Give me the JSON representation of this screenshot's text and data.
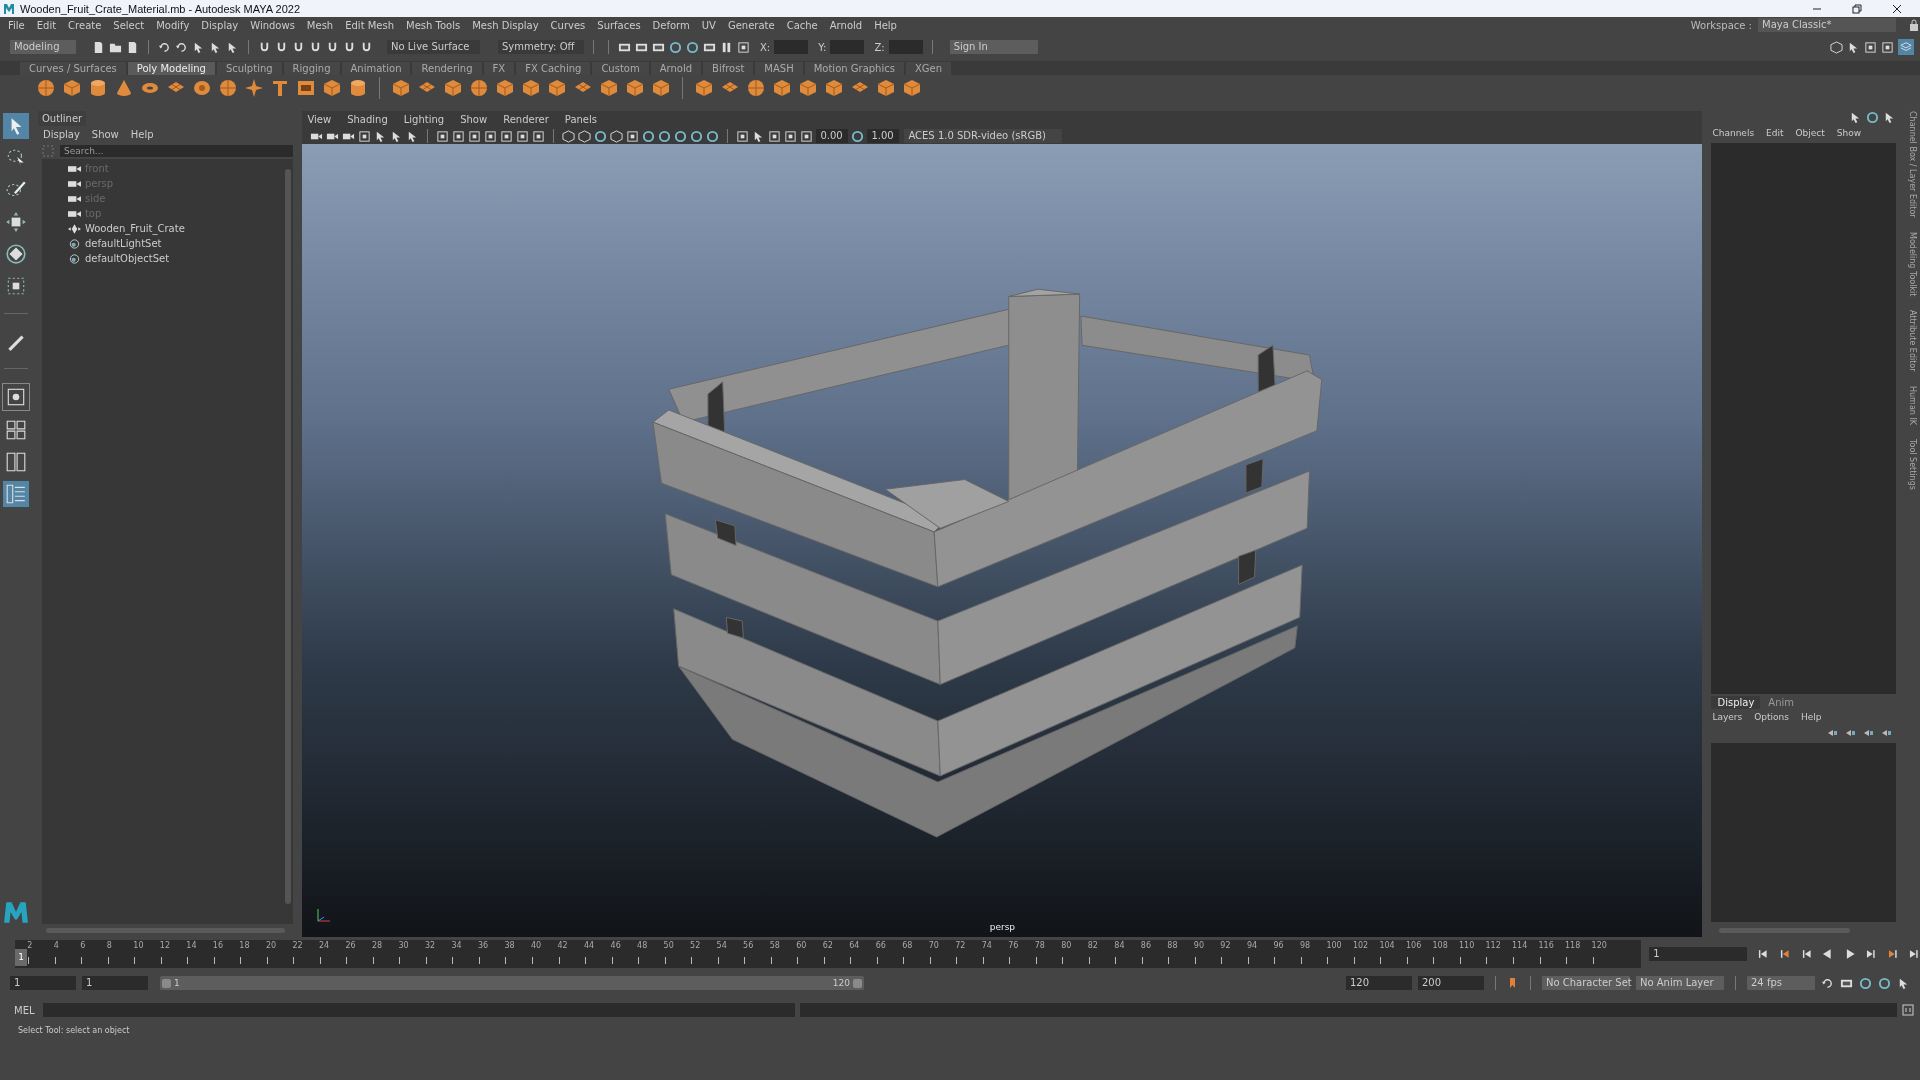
{
  "window": {
    "title": "Wooden_Fruit_Crate_Material.mb - Autodesk MAYA 2022"
  },
  "menu": [
    "File",
    "Edit",
    "Create",
    "Select",
    "Modify",
    "Display",
    "Windows",
    "Mesh",
    "Edit Mesh",
    "Mesh Tools",
    "Mesh Display",
    "Curves",
    "Surfaces",
    "Deform",
    "UV",
    "Generate",
    "Cache",
    "Arnold",
    "Help"
  ],
  "workspace": {
    "label": "Workspace :",
    "value": "Maya Classic*"
  },
  "status_line": {
    "menu_set": "Modeling",
    "live_surface": "No Live Surface",
    "symmetry": "Symmetry: Off",
    "x_label": "X:",
    "y_label": "Y:",
    "z_label": "Z:",
    "sign_in": "Sign In"
  },
  "shelf_tabs": [
    {
      "label": "Curves / Surfaces",
      "selected": false
    },
    {
      "label": "Poly Modeling",
      "selected": true
    },
    {
      "label": "Sculpting",
      "selected": false
    },
    {
      "label": "Rigging",
      "selected": false
    },
    {
      "label": "Animation",
      "selected": false
    },
    {
      "label": "Rendering",
      "selected": false
    },
    {
      "label": "FX",
      "selected": false
    },
    {
      "label": "FX Caching",
      "selected": false
    },
    {
      "label": "Custom",
      "selected": false
    },
    {
      "label": "Arnold",
      "selected": false
    },
    {
      "label": "Bifrost",
      "selected": false
    },
    {
      "label": "MASH",
      "selected": false
    },
    {
      "label": "Motion Graphics",
      "selected": false
    },
    {
      "label": "XGen",
      "selected": false
    }
  ],
  "outliner": {
    "title": "Outliner",
    "menu": [
      "Display",
      "Show",
      "Help"
    ],
    "search": {
      "placeholder": "Search..."
    },
    "items": [
      {
        "label": "front",
        "kind": "camera",
        "hidden": true
      },
      {
        "label": "persp",
        "kind": "camera",
        "hidden": true
      },
      {
        "label": "side",
        "kind": "camera",
        "hidden": true
      },
      {
        "label": "top",
        "kind": "camera",
        "hidden": true
      },
      {
        "label": "Wooden_Fruit_Crate",
        "kind": "transform",
        "hidden": false
      },
      {
        "label": "defaultLightSet",
        "kind": "set",
        "hidden": false
      },
      {
        "label": "defaultObjectSet",
        "kind": "set",
        "hidden": false
      }
    ]
  },
  "viewport": {
    "menu": [
      "View",
      "Shading",
      "Lighting",
      "Show",
      "Renderer",
      "Panels"
    ],
    "exposure": "0.00",
    "gamma": "1.00",
    "color_space": "ACES 1.0 SDR-video (sRGB)",
    "camera_label": "persp"
  },
  "channel_box": {
    "menu": [
      "Channels",
      "Edit",
      "Object",
      "Show"
    ]
  },
  "layer_editor": {
    "tabs": [
      {
        "label": "Display",
        "selected": true
      },
      {
        "label": "Anim",
        "selected": false
      }
    ],
    "menu": [
      "Layers",
      "Options",
      "Help"
    ]
  },
  "side_tabs": [
    "Channel Box / Layer Editor",
    "Modeling Toolkit",
    "Attribute Editor",
    "Human IK",
    "Tool Settings"
  ],
  "time_slider": {
    "level": 0,
    "current_frame": "1",
    "frame_field": "1",
    "ticks": [
      "2",
      "4",
      "6",
      "8",
      "10",
      "12",
      "14",
      "16",
      "18",
      "20",
      "22",
      "24",
      "26",
      "28",
      "30",
      "32",
      "34",
      "36",
      "38",
      "40",
      "42",
      "44",
      "46",
      "48",
      "50",
      "52",
      "54",
      "56",
      "58",
      "60",
      "62",
      "64",
      "66",
      "68",
      "70",
      "72",
      "74",
      "76",
      "78",
      "80",
      "82",
      "84",
      "86",
      "88",
      "90",
      "92",
      "94",
      "96",
      "98",
      "100",
      "102",
      "104",
      "106",
      "108",
      "110",
      "112",
      "114",
      "116",
      "118",
      "120"
    ]
  },
  "range_slider": {
    "level": 1,
    "start": "1",
    "playback_start": "1",
    "range_start": "1",
    "range_end": "120",
    "playback_end": "120",
    "end": "200",
    "character_set": "No Character Set",
    "anim_layer": "No Anim Layer",
    "fps": "24 fps"
  },
  "command_line": {
    "language": "MEL"
  },
  "help_line": "Select Tool: select an object"
}
